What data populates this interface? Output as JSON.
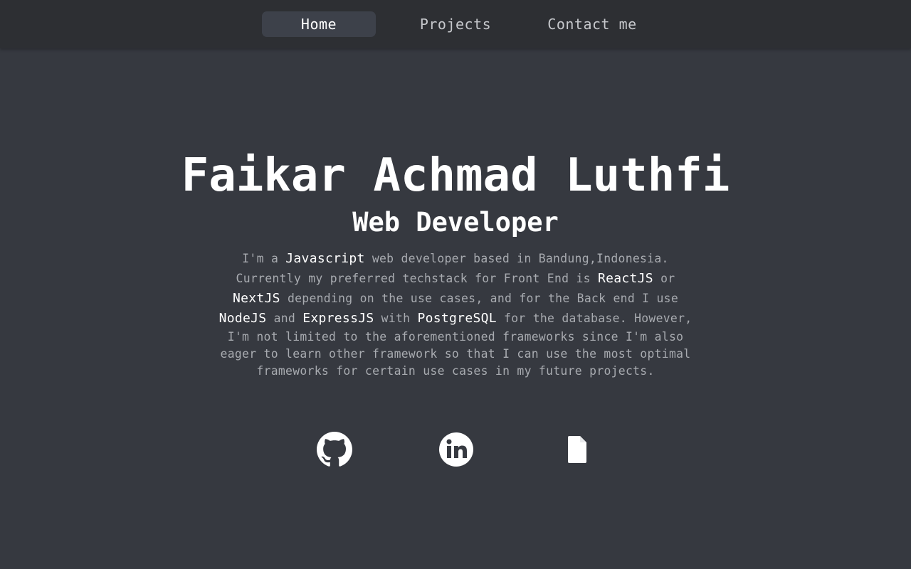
{
  "nav": {
    "items": [
      {
        "label": "Home",
        "active": true
      },
      {
        "label": "Projects",
        "active": false
      },
      {
        "label": "Contact me",
        "active": false
      }
    ]
  },
  "hero": {
    "name": "Faikar Achmad Luthfi",
    "role": "Web Developer"
  },
  "bio": {
    "l1_a": "I'm a ",
    "l1_b": "Javascript",
    "l1_c": " web developer based in Bandung,Indonesia.",
    "l2_a": "Currently my preferred techstack for Front End is ",
    "l2_b": "ReactJS",
    "l2_c": " or",
    "l3_a": "NextJS",
    "l3_b": " depending on the use cases, and for the Back end I use",
    "l4_a": "NodeJS",
    "l4_b": " and ",
    "l4_c": "ExpressJS",
    "l4_d": " with ",
    "l4_e": "PostgreSQL",
    "l4_f": " for the database. However,",
    "l5": "I'm not limited to the aforementioned frameworks since I'm also",
    "l6": "eager to learn other framework so that I can use the most optimal",
    "l7": "frameworks for certain use cases in my future projects."
  },
  "social": {
    "icons": [
      "github-icon",
      "linkedin-icon",
      "file-icon"
    ]
  },
  "colors": {
    "background": "#363940",
    "navbar": "#2d2f33",
    "active_tab": "#3d414a",
    "text_primary": "#ffffff",
    "text_muted": "#a8abb0"
  }
}
